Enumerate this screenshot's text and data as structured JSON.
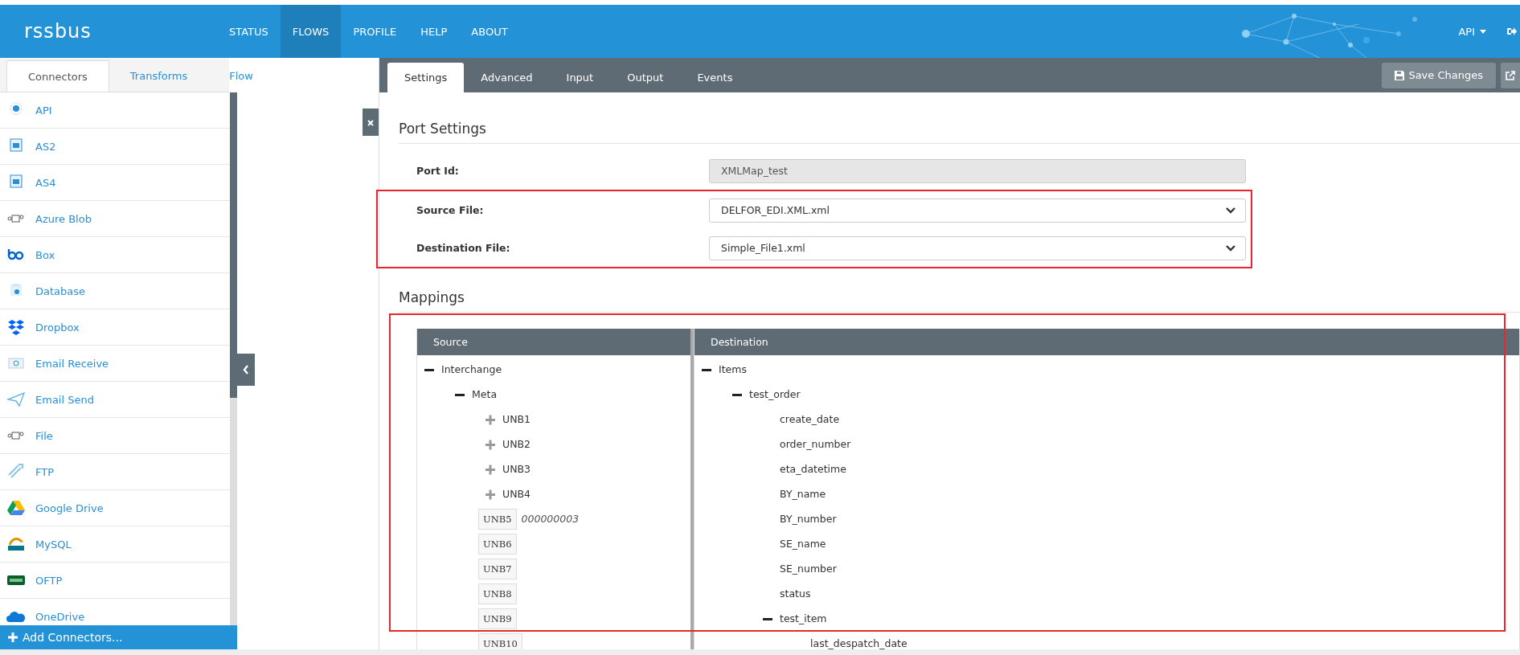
{
  "header": {
    "logo": "rssbus",
    "nav": [
      {
        "label": "STATUS",
        "selected": false
      },
      {
        "label": "FLOWS",
        "selected": true
      },
      {
        "label": "PROFILE",
        "selected": false
      },
      {
        "label": "HELP",
        "selected": false
      },
      {
        "label": "ABOUT",
        "selected": false
      }
    ],
    "user_menu": "API"
  },
  "sidebar": {
    "tabs": [
      {
        "label": "Connectors",
        "selected": true
      },
      {
        "label": "Transforms",
        "selected": false
      },
      {
        "label": "Flow",
        "selected": false
      }
    ],
    "items": [
      {
        "label": "API"
      },
      {
        "label": "AS2"
      },
      {
        "label": "AS4"
      },
      {
        "label": "Azure Blob"
      },
      {
        "label": "Box"
      },
      {
        "label": "Database"
      },
      {
        "label": "Dropbox"
      },
      {
        "label": "Email Receive"
      },
      {
        "label": "Email Send"
      },
      {
        "label": "File"
      },
      {
        "label": "FTP"
      },
      {
        "label": "Google Drive"
      },
      {
        "label": "MySQL"
      },
      {
        "label": "OFTP"
      },
      {
        "label": "OneDrive"
      }
    ],
    "add_button": "Add Connectors..."
  },
  "panel": {
    "tabs": [
      {
        "label": "Settings",
        "selected": true
      },
      {
        "label": "Advanced",
        "selected": false
      },
      {
        "label": "Input",
        "selected": false
      },
      {
        "label": "Output",
        "selected": false
      },
      {
        "label": "Events",
        "selected": false
      }
    ],
    "save_button": "Save Changes",
    "port_settings": {
      "title": "Port Settings",
      "fields": [
        {
          "label": "Port Id:",
          "value": "XMLMap_test",
          "kind": "text",
          "disabled": true
        },
        {
          "label": "Source File:",
          "value": "DELFOR_EDI.XML.xml",
          "kind": "select",
          "disabled": false
        },
        {
          "label": "Destination File:",
          "value": "Simple_File1.xml",
          "kind": "select",
          "disabled": false
        }
      ]
    },
    "mappings": {
      "title": "Mappings",
      "source_header": "Source",
      "destination_header": "Destination",
      "source_tree": [
        {
          "label": "Interchange",
          "kind": "group",
          "expanded": true,
          "children": [
            {
              "label": "Meta",
              "kind": "group",
              "expanded": true,
              "children": [
                {
                  "label": "UNB1",
                  "kind": "group",
                  "expanded": false
                },
                {
                  "label": "UNB2",
                  "kind": "group",
                  "expanded": false
                },
                {
                  "label": "UNB3",
                  "kind": "group",
                  "expanded": false
                },
                {
                  "label": "UNB4",
                  "kind": "group",
                  "expanded": false
                },
                {
                  "label": "UNB5",
                  "kind": "element",
                  "value": "000000003"
                },
                {
                  "label": "UNB6",
                  "kind": "element"
                },
                {
                  "label": "UNB7",
                  "kind": "element"
                },
                {
                  "label": "UNB8",
                  "kind": "element"
                },
                {
                  "label": "UNB9",
                  "kind": "element"
                },
                {
                  "label": "UNB10",
                  "kind": "element"
                }
              ]
            }
          ]
        }
      ],
      "destination_tree": [
        {
          "label": "Items",
          "kind": "group",
          "expanded": true,
          "children": [
            {
              "label": "test_order",
              "kind": "group",
              "expanded": true,
              "children": [
                {
                  "label": "create_date",
                  "kind": "leaf"
                },
                {
                  "label": "order_number",
                  "kind": "leaf"
                },
                {
                  "label": "eta_datetime",
                  "kind": "leaf"
                },
                {
                  "label": "BY_name",
                  "kind": "leaf"
                },
                {
                  "label": "BY_number",
                  "kind": "leaf"
                },
                {
                  "label": "SE_name",
                  "kind": "leaf"
                },
                {
                  "label": "SE_number",
                  "kind": "leaf"
                },
                {
                  "label": "status",
                  "kind": "leaf"
                },
                {
                  "label": "test_item",
                  "kind": "group",
                  "expanded": true,
                  "children": [
                    {
                      "label": "last_despatch_date",
                      "kind": "leaf"
                    }
                  ]
                }
              ]
            }
          ]
        }
      ]
    }
  }
}
